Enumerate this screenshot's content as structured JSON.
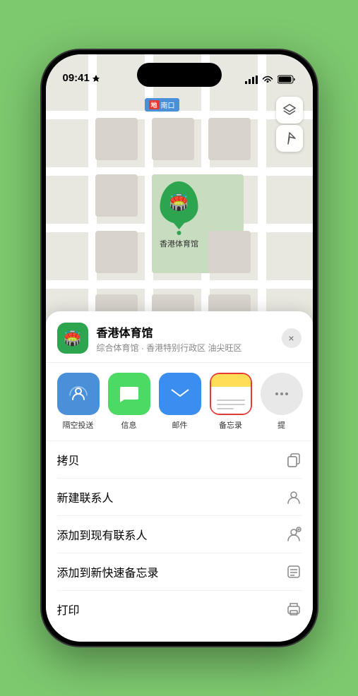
{
  "phone": {
    "status_bar": {
      "time": "09:41",
      "signal_bars": 4,
      "wifi_signal": true,
      "battery": "full"
    }
  },
  "map": {
    "subway_label": "南口",
    "venue_marker_name": "香港体育馆",
    "map_btn_layers": "layers",
    "map_btn_location": "location"
  },
  "venue_sheet": {
    "title": "香港体育馆",
    "subtitle": "综合体育馆 · 香港特别行政区 油尖旺区",
    "close_label": "×"
  },
  "share_row": {
    "items": [
      {
        "id": "airdrop",
        "label": "隔空投送",
        "type": "airdrop"
      },
      {
        "id": "messages",
        "label": "信息",
        "type": "messages"
      },
      {
        "id": "mail",
        "label": "邮件",
        "type": "mail"
      },
      {
        "id": "notes",
        "label": "备忘录",
        "type": "notes"
      },
      {
        "id": "more",
        "label": "提",
        "type": "more"
      }
    ]
  },
  "actions": [
    {
      "id": "copy",
      "label": "拷贝",
      "icon": "copy"
    },
    {
      "id": "new-contact",
      "label": "新建联系人",
      "icon": "person-add"
    },
    {
      "id": "add-existing",
      "label": "添加到现有联系人",
      "icon": "person-plus"
    },
    {
      "id": "quick-note",
      "label": "添加到新快速备忘录",
      "icon": "note"
    },
    {
      "id": "print",
      "label": "打印",
      "icon": "print"
    }
  ]
}
